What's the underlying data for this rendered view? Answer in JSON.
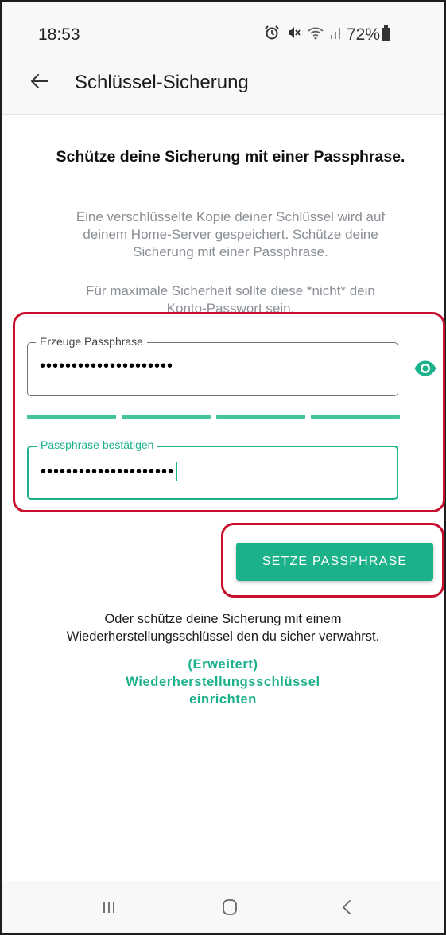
{
  "status_bar": {
    "time": "18:53",
    "battery": "72%",
    "icons": [
      "alarm-icon",
      "mute-icon",
      "wifi-icon",
      "signal-icon",
      "battery-icon"
    ]
  },
  "toolbar": {
    "title": "Schlüssel-Sicherung",
    "back_icon": "arrow-left-icon"
  },
  "content": {
    "headline": "Schütze deine Sicherung mit einer Passphrase.",
    "description_lines": [
      "Eine verschlüsselte Kopie deiner Schlüssel wird auf",
      "deinem Home-Server gespeichert. Schütze deine",
      "Sicherung mit einer Passphrase."
    ],
    "warning_lines": [
      "Für maximale Sicherheit sollte diese *nicht* dein",
      "Konto-Passwort sein."
    ]
  },
  "form": {
    "passphrase": {
      "label": "Erzeuge Passphrase",
      "value": "•••••••••••••••••••••"
    },
    "confirm": {
      "label": "Passphrase bestätigen",
      "value": "•••••••••••••••••••••"
    },
    "strength_segments": 4,
    "submit_label": "SETZE PASSPHRASE"
  },
  "alternative": {
    "text_lines": [
      "Oder schütze deine Sicherung mit einem",
      "Wiederherstellungsschlüssel den du sicher verwahrst."
    ],
    "link_lines": [
      "(Erweitert)",
      "Wiederherstellungsschlüssel",
      "einrichten"
    ]
  },
  "colors": {
    "accent": "#1bb18b",
    "annotation": "#c8102e",
    "secondary_text": "#8a8f95"
  },
  "nav": [
    "recent-apps-icon",
    "home-icon",
    "back-icon"
  ]
}
